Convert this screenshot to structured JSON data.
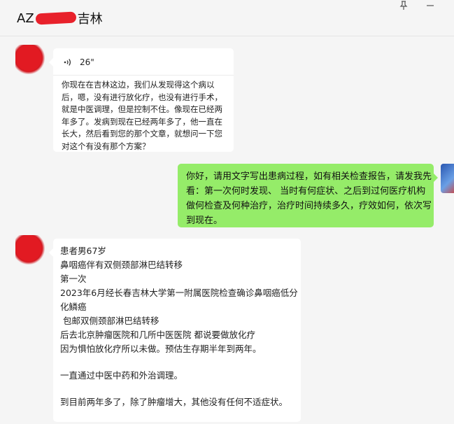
{
  "header": {
    "title_prefix": "AZ",
    "title_suffix": "吉林",
    "redaction_color": "#e8212b"
  },
  "window_controls": {
    "pin_icon": "pin-icon",
    "minimize_icon": "minimize-icon"
  },
  "messages": [
    {
      "sender": "contact",
      "type": "voice",
      "duration": "26\"",
      "transcript": "你现在在吉林这边，我们从发现得这个病以后，嗯，没有进行放化疗，也没有进行手术，就是中医调理，但是控制不住。像现在已经两年多了。发病到现在已经两年多了，他一直在长大，然后看到您的那个文章，就想问一下您对这个有没有那个方案？"
    },
    {
      "sender": "self",
      "type": "text",
      "text": "你好，请用文字写出患病过程，如有相关检查报告，请发我先看：第一次何时发现、 当时有何症状、之后到过何医疗机构做何检查及何种治疗，治疗时间持续多久，疗效如何，依次写到现在。",
      "bubble_color": "#95ec69"
    },
    {
      "sender": "contact",
      "type": "text",
      "lines": [
        "患者男67岁",
        "鼻咽癌伴有双侧颈部淋巴结转移",
        "第一次",
        "2023年6月经长春吉林大学第一附属医院检查确诊鼻咽癌低分化鳞癌",
        " 包邮双侧颈部淋巴结转移",
        "后去北京肿瘤医院和几所中医医院 都说要做放化疗",
        "因为惧怕放化疗所以未做。预估生存期半年到两年。",
        "",
        "一直通过中医中药和外治调理。",
        "",
        "到目前两年多了，除了肿瘤增大，其他没有任何不适症状。"
      ]
    }
  ]
}
